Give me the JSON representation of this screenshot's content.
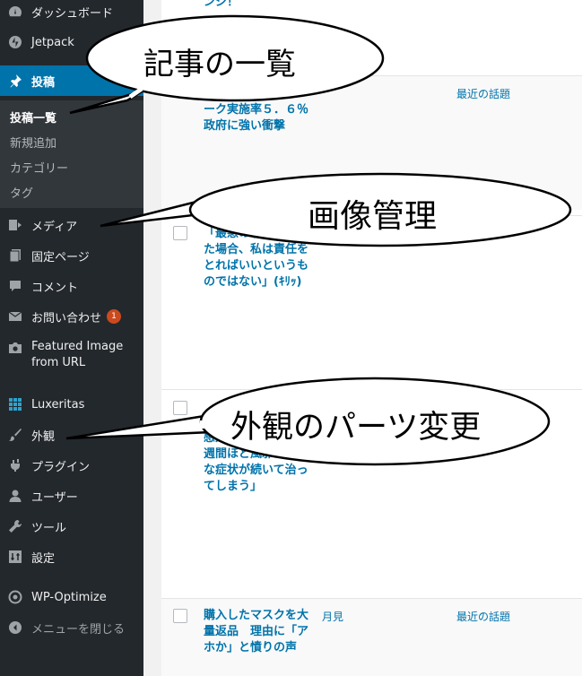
{
  "sidebar": {
    "items": [
      {
        "label": "ダッシュボード",
        "icon": "dashboard-icon"
      },
      {
        "label": "Jetpack",
        "icon": "jetpack-icon"
      },
      {
        "label": "投稿",
        "icon": "pin-icon"
      },
      {
        "label": "メディア",
        "icon": "media-icon"
      },
      {
        "label": "固定ページ",
        "icon": "pages-icon"
      },
      {
        "label": "コメント",
        "icon": "comment-icon"
      },
      {
        "label": "お問い合わせ",
        "icon": "mail-icon",
        "badge": "1"
      },
      {
        "label": "Featured Image from URL",
        "icon": "camera-icon"
      },
      {
        "label": "Luxeritas",
        "icon": "grid-icon"
      },
      {
        "label": "外観",
        "icon": "brush-icon"
      },
      {
        "label": "プラグイン",
        "icon": "plugin-icon"
      },
      {
        "label": "ユーザー",
        "icon": "user-icon"
      },
      {
        "label": "ツール",
        "icon": "wrench-icon"
      },
      {
        "label": "設定",
        "icon": "settings-icon"
      },
      {
        "label": "WP-Optimize",
        "icon": "wpo-icon"
      },
      {
        "label": "メニューを閉じる",
        "icon": "collapse-icon"
      }
    ],
    "submenu": [
      "投稿一覧",
      "新規追加",
      "カテゴリー",
      "タグ"
    ]
  },
  "posts": [
    {
      "title": "ンジ！",
      "author": "",
      "category": ""
    },
    {
      "title": "ーク実施率５．６％ 政府に強い衝撃",
      "author": "",
      "category": "最近の話題"
    },
    {
      "title": "「最悪の事態になった場合、私は責任をとればいいというものではない」(ｷﾘｯ)",
      "author": "",
      "category": ""
    },
    {
      "title": "感染者の軽症で、1週間ほど風邪のような症状が続いて治ってしまう」",
      "author": "",
      "category": ""
    },
    {
      "title": "購入したマスクを大量返品　理由に「アホか」と憤りの声",
      "author": "月見",
      "category": "最近の話題"
    }
  ],
  "annotations": {
    "posts_list": "記事の一覧",
    "media": "画像管理",
    "appearance": "外観のパーツ変更"
  },
  "colors": {
    "sidebar_bg": "#23282d",
    "active_bg": "#0073aa",
    "link": "#0073aa",
    "badge": "#ca4a1f"
  }
}
